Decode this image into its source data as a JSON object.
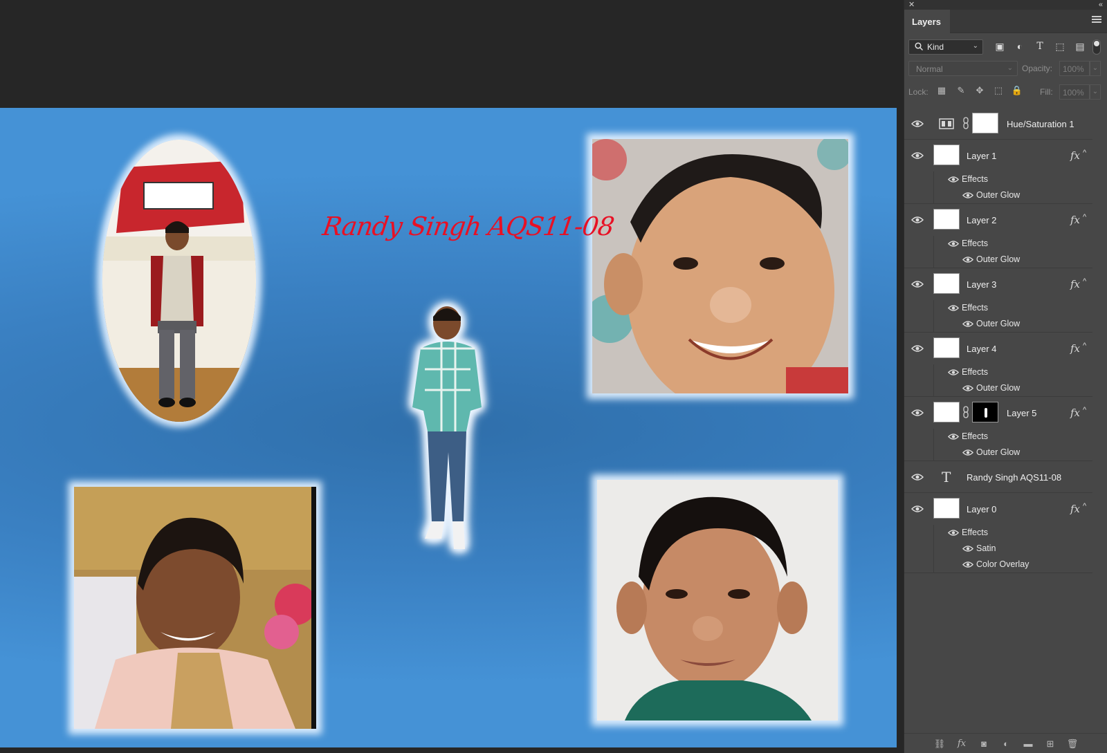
{
  "panel": {
    "tab_title": "Layers",
    "filter_kind": "Kind",
    "blend_mode": "Normal",
    "opacity_label": "Opacity:",
    "opacity_value": "100%",
    "lock_label": "Lock:",
    "fill_label": "Fill:",
    "fill_value": "100%"
  },
  "canvas": {
    "title_text": "Randy Singh AQS11-08",
    "title_color": "#e81024",
    "background_color": "#3a80c2"
  },
  "layers": [
    {
      "name": "Hue/Saturation 1",
      "type": "adjustment",
      "effects": []
    },
    {
      "name": "Layer 1",
      "type": "pixel",
      "fx": "fx",
      "effects_label": "Effects",
      "effects": [
        "Outer Glow"
      ]
    },
    {
      "name": "Layer 2",
      "type": "pixel",
      "fx": "fx",
      "effects_label": "Effects",
      "effects": [
        "Outer Glow"
      ]
    },
    {
      "name": "Layer 3",
      "type": "pixel",
      "fx": "fx",
      "effects_label": "Effects",
      "effects": [
        "Outer Glow"
      ]
    },
    {
      "name": "Layer 4",
      "type": "pixel",
      "fx": "fx",
      "effects_label": "Effects",
      "effects": [
        "Outer Glow"
      ]
    },
    {
      "name": "Layer 5",
      "type": "masked",
      "fx": "fx",
      "effects_label": "Effects",
      "effects": [
        "Outer Glow"
      ]
    },
    {
      "name": "Randy Singh AQS11-08",
      "type": "text",
      "effects": []
    },
    {
      "name": "Layer 0",
      "type": "pixel",
      "fx": "fx",
      "effects_label": "Effects",
      "effects": [
        "Satin",
        "Color Overlay"
      ]
    }
  ],
  "icons": {
    "visibility": "eye-icon",
    "filter_search": "search-icon",
    "text_layer": "text-layer-icon",
    "chain": "link-icon",
    "menu": "panel-menu-icon"
  }
}
